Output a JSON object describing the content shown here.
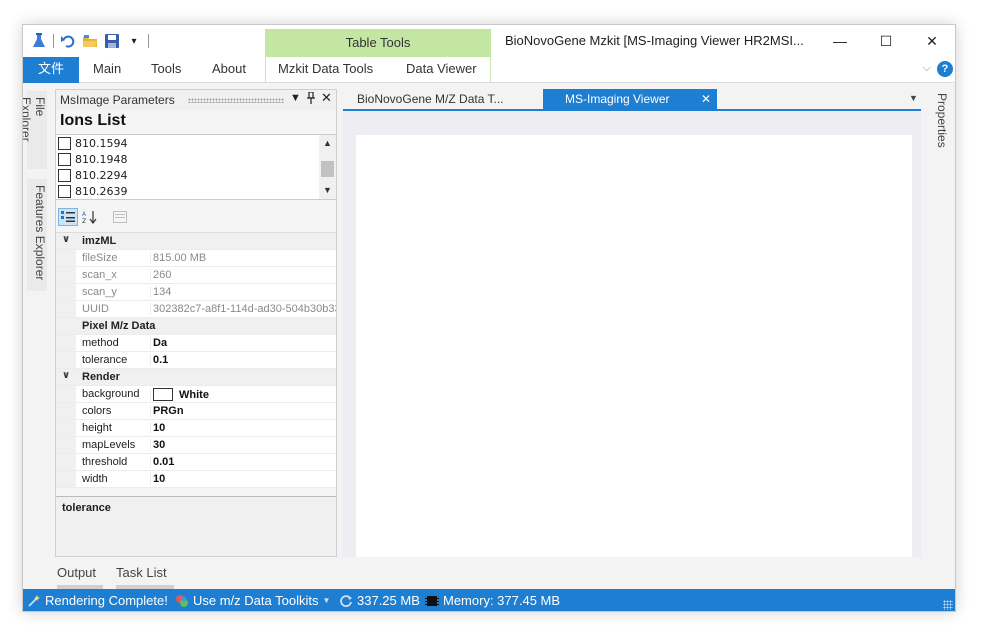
{
  "titlebar": {
    "context_group": "Table Tools",
    "title": "BioNovoGene Mzkit [MS-Imaging Viewer HR2MSI...",
    "minimize": "—",
    "maximize": "☐",
    "close": "✕"
  },
  "ribbon": {
    "file_tab": "文件",
    "tabs": [
      "Main",
      "Tools",
      "About"
    ],
    "context_tabs": [
      "Mzkit Data Tools",
      "Data Viewer"
    ],
    "help": "?",
    "collapse": "⌵"
  },
  "left_strip": {
    "tabs": [
      "File Explorer",
      "Features Explorer"
    ]
  },
  "panel": {
    "title": "MsImage Parameters",
    "ions_heading": "Ions List",
    "ions": [
      "810.1594",
      "810.1948",
      "810.2294",
      "810.2639"
    ],
    "property_grid": {
      "categories": [
        {
          "name": "imzML",
          "rows": [
            {
              "name": "fileSize",
              "value": "815.00 MB"
            },
            {
              "name": "scan_x",
              "value": "260"
            },
            {
              "name": "scan_y",
              "value": "134"
            },
            {
              "name": "UUID",
              "value": "302382c7-a8f1-114d-ad30-504b30b33"
            }
          ]
        },
        {
          "name": "Pixel M/z Data",
          "rows": [
            {
              "name": "method",
              "value": "Da"
            },
            {
              "name": "tolerance",
              "value": "0.1"
            }
          ]
        },
        {
          "name": "Render",
          "rows": [
            {
              "name": "background",
              "value": "White"
            },
            {
              "name": "colors",
              "value": "PRGn"
            },
            {
              "name": "height",
              "value": "10"
            },
            {
              "name": "mapLevels",
              "value": "30"
            },
            {
              "name": "threshold",
              "value": "0.01"
            },
            {
              "name": "width",
              "value": "10"
            }
          ]
        }
      ]
    },
    "description_title": "tolerance"
  },
  "documents": {
    "tabs": [
      "BioNovoGene M/Z Data T...",
      "MS-Imaging Viewer"
    ],
    "active_tab": "MS-Imaging Viewer"
  },
  "right_strip": {
    "tabs": [
      "Properties"
    ]
  },
  "bottom_tabs": [
    "Output",
    "Task List"
  ],
  "status": {
    "message": "Rendering Complete!",
    "toolkit": "Use m/z Data Toolkits",
    "data_size": "337.25 MB",
    "memory": "Memory: 377.45 MB"
  },
  "colors": {
    "accent": "#1e7ed2",
    "context_group": "#c3e6a2",
    "status_bar": "#1e7ed2"
  }
}
